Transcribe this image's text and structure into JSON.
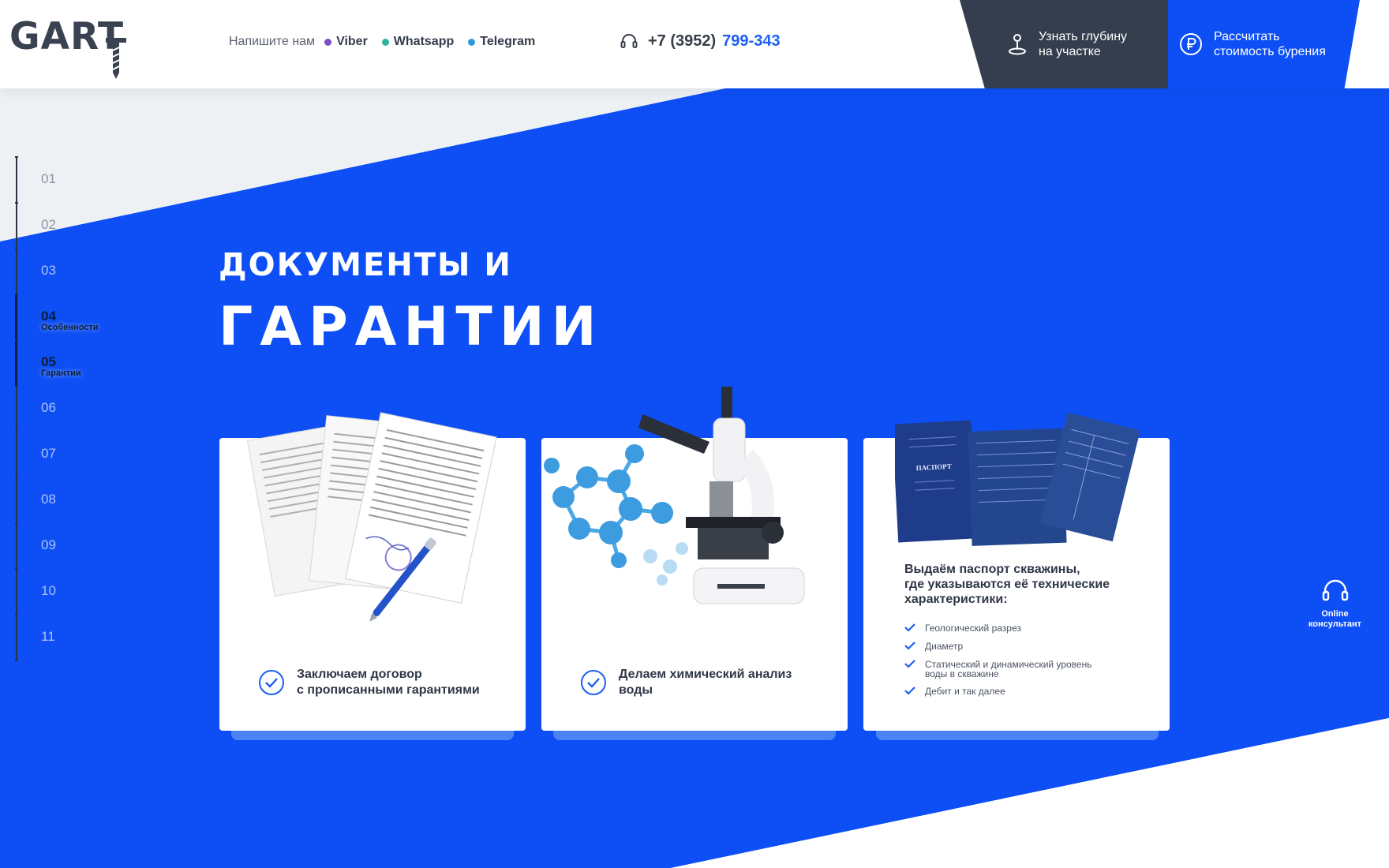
{
  "header": {
    "logo": "GART",
    "write_label": "Напишите нам",
    "messengers": [
      {
        "label": "Viber",
        "color": "#7b4fc8"
      },
      {
        "label": "Whatsapp",
        "color": "#2bb3a0"
      },
      {
        "label": "Telegram",
        "color": "#2a9be0"
      }
    ],
    "phone_prefix": "+7 (3952)",
    "phone_main": "799-343",
    "btn_depth": "Узнать глубину\nна участке",
    "btn_cost": "Рассчитать\nстоимость бурения"
  },
  "sidenav": {
    "items": [
      {
        "num": "01",
        "sub": ""
      },
      {
        "num": "02",
        "sub": ""
      },
      {
        "num": "03",
        "sub": ""
      },
      {
        "num": "04",
        "sub": "Особенности"
      },
      {
        "num": "05",
        "sub": "Гарантии"
      },
      {
        "num": "06",
        "sub": ""
      },
      {
        "num": "07",
        "sub": ""
      },
      {
        "num": "08",
        "sub": ""
      },
      {
        "num": "09",
        "sub": ""
      },
      {
        "num": "10",
        "sub": ""
      },
      {
        "num": "11",
        "sub": ""
      }
    ]
  },
  "hero": {
    "title_line1": "ДОКУМЕНТЫ И",
    "title_line2": "ГАРАНТИИ"
  },
  "cards": [
    {
      "caption": "Заключаем договор\nс прописанными гарантиями"
    },
    {
      "caption": "Делаем химический анализ\nводы"
    },
    {
      "title": "Выдаём паспорт скважины,\nгде указываются её технические\nхарактеристики:",
      "passport_label": "ПАСПОРТ",
      "list": [
        "Геологический разрез",
        "Диаметр",
        "Статический и динамический уровень\nводы в скважине",
        "Дебит и так далее"
      ]
    }
  ],
  "consultant": {
    "label": "Online\nконсультант"
  },
  "colors": {
    "brand_blue": "#0d4ff5",
    "dark": "#353e4e",
    "accent": "#1c5ef5"
  }
}
